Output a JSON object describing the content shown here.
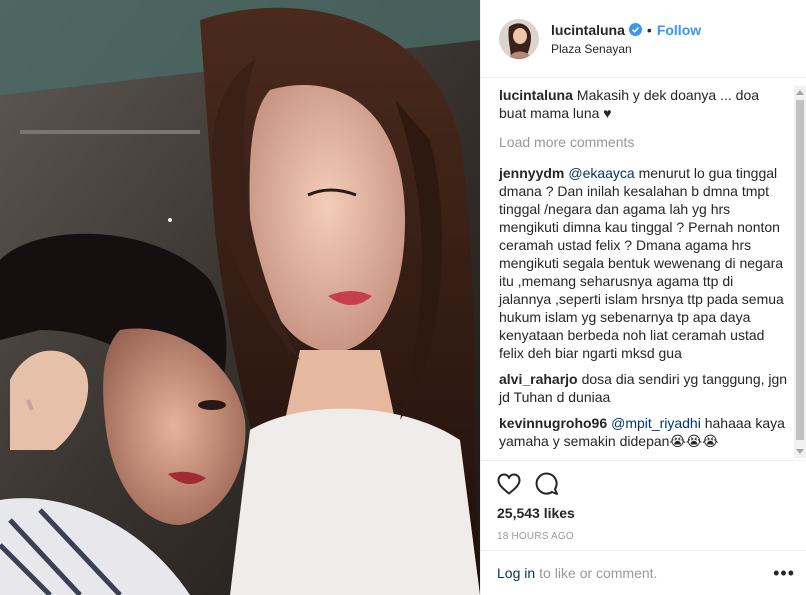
{
  "header": {
    "username": "lucintaluna",
    "separator": "•",
    "follow_label": "Follow",
    "location": "Plaza Senayan",
    "verified_icon": "verified-badge-icon",
    "verified_color": "#3897f0"
  },
  "caption": {
    "username": "lucintaluna",
    "text": "Makasih y dek doanya ... doa buat mama luna",
    "heart": "♥"
  },
  "load_more": "Load more comments",
  "comments": [
    {
      "username": "jennyydm",
      "mention": "@ekaayca",
      "text": "menurut lo gua tinggal dmana ? Dan inilah kesalahan b dmna tmpt tinggal /negara dan agama lah yg hrs mengikuti dimna kau tinggal ? Pernah nonton ceramah ustad felix ? Dmana agama hrs mengikuti segala bentuk wewenang di negara itu ,memang seharusnya agama ttp di jalannya ,seperti islam hrsnya ttp pada semua hukum islam yg sebenarnya tp apa daya kenyataan berbeda noh liat ceramah ustad felix deh biar ngarti mksd gua"
    },
    {
      "username": "alvi_raharjo",
      "mention": "",
      "text": "dosa dia sendiri yg tanggung, jgn jd Tuhan d duniaa"
    },
    {
      "username": "kevinnugroho96",
      "mention": "@mpit_riyadhi",
      "text": "hahaaa kaya yamaha y semakin didepan😭😭😭"
    }
  ],
  "actions": {
    "like_icon": "heart-outline-icon",
    "comment_icon": "comment-bubble-icon",
    "likes": "25,543 likes",
    "time_ago": "18 HOURS AGO"
  },
  "footer": {
    "login_label": "Log in",
    "login_rest": "to like or comment.",
    "more_label": "•••"
  },
  "colors": {
    "accent": "#3897f0",
    "link": "#003569",
    "muted": "#999999",
    "border": "#efefef"
  }
}
